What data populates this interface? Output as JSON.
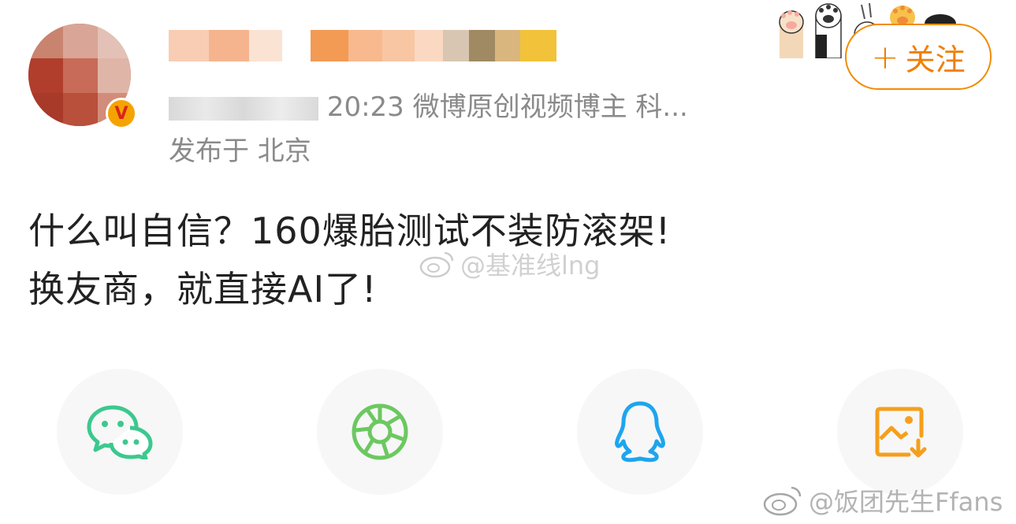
{
  "post": {
    "meta": "20 07 30 20:23 微博原创视频博主 科...",
    "meta_time": "20:23",
    "meta_tags": "微博原创视频博主 科...",
    "location": "发布于 北京",
    "text_line1": "什么叫自信？160爆胎测试不装防滚架!",
    "text_line2": "换友商，就直接AI了!"
  },
  "follow_button": {
    "plus": "+",
    "label": "关注"
  },
  "watermarks": {
    "inline": "@基准线lng",
    "corner": "@饭团先生Ffans"
  },
  "share": {
    "items": [
      {
        "name": "wechat",
        "color": "#3cc88f"
      },
      {
        "name": "moments",
        "color": "#6cc860"
      },
      {
        "name": "qq",
        "color": "#1ea5ef"
      },
      {
        "name": "save-image",
        "color": "#f59f1c"
      }
    ]
  },
  "colors": {
    "accent": "#ef7f00",
    "meta_text": "#8a8a8a",
    "body_text": "#222222",
    "share_bg": "#f7f7f7"
  }
}
